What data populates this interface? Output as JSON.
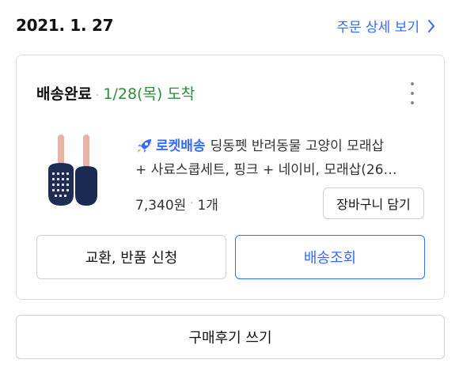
{
  "order": {
    "date": "2021. 1. 27",
    "detail_link_label": "주문 상세 보기"
  },
  "shipment": {
    "status": "배송완료",
    "arrival": "1/28(목) 도착"
  },
  "product": {
    "badge": "로켓배송",
    "name_line1": "딩동펫 반려동물 고양이 모래삽",
    "name_line2": "+ 사료스쿱세트, 핑크 + 네이비, 모래삽(26…",
    "price": "7,340원",
    "quantity": "1개",
    "image_icon": "litter-scoop-set-image"
  },
  "actions": {
    "add_to_cart": "장바구니 담기",
    "exchange_return": "교환, 반품 신청",
    "track_delivery": "배송조회",
    "write_review": "구매후기 쓰기"
  },
  "colors": {
    "accent": "#346aff",
    "arrival": "#2e8b3d",
    "border": "#dcdcdc"
  }
}
